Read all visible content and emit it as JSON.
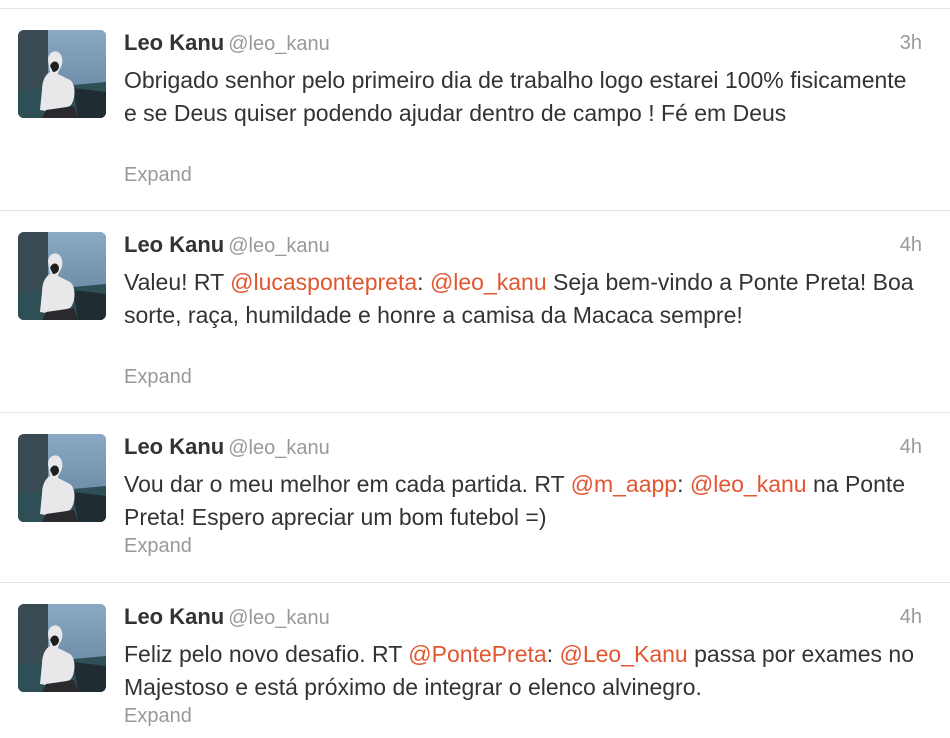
{
  "colors": {
    "mention": "#e2562f",
    "meta_text": "#999999",
    "body_text": "#333333",
    "divider": "#e4e4e4"
  },
  "tweets": [
    {
      "avatar_icon": "profile-photo-icon",
      "fullname": "Leo Kanu",
      "username": "@leo_kanu",
      "time": "3h",
      "segments": [
        {
          "t": "Obrigado senhor pelo primeiro dia de trabalho logo estarei 100% fisicamente e se Deus quiser podendo ajudar dentro de campo ! Fé em Deus",
          "m": false
        }
      ],
      "expand": "Expand"
    },
    {
      "avatar_icon": "profile-photo-icon",
      "fullname": "Leo Kanu",
      "username": "@leo_kanu",
      "time": "4h",
      "segments": [
        {
          "t": "Valeu! RT ",
          "m": false
        },
        {
          "t": "@lucaspontepreta",
          "m": true
        },
        {
          "t": ": ",
          "m": false
        },
        {
          "t": "@leo_kanu",
          "m": true
        },
        {
          "t": " Seja bem-vindo a Ponte Preta! Boa sorte, raça, humildade e honre a camisa da Macaca sempre!",
          "m": false
        }
      ],
      "expand": "Expand"
    },
    {
      "avatar_icon": "profile-photo-icon",
      "fullname": "Leo Kanu",
      "username": "@leo_kanu",
      "time": "4h",
      "segments": [
        {
          "t": "Vou dar o meu melhor em cada partida. RT ",
          "m": false
        },
        {
          "t": "@m_aapp",
          "m": true
        },
        {
          "t": ": ",
          "m": false
        },
        {
          "t": "@leo_kanu",
          "m": true
        },
        {
          "t": " na Ponte Preta! Espero apreciar um bom futebol =)",
          "m": false
        }
      ],
      "expand": "Expand"
    },
    {
      "avatar_icon": "profile-photo-icon",
      "fullname": "Leo Kanu",
      "username": "@leo_kanu",
      "time": "4h",
      "segments": [
        {
          "t": "Feliz pelo novo desafio. RT ",
          "m": false
        },
        {
          "t": "@PontePreta",
          "m": true
        },
        {
          "t": ": ",
          "m": false
        },
        {
          "t": "@Leo_Kanu",
          "m": true
        },
        {
          "t": " passa por exames no Majestoso e está próximo de integrar o elenco alvinegro.",
          "m": false
        }
      ],
      "expand": "Expand"
    }
  ]
}
